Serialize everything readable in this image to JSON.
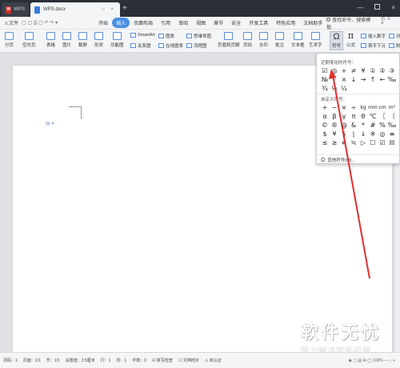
{
  "titlebar": {
    "home_tab": "WPS",
    "home_logo": "W",
    "doc_tab": "WPS.docx",
    "doc_tab_ctrls": "○ ×",
    "new_tab": "+",
    "min": "—",
    "close": "×"
  },
  "menubar": {
    "file": "≡ 文件",
    "quick_access": "▢ ▢ ⎙ ▢ ↶ ↷ ▾",
    "items": [
      "开始",
      "插入",
      "页面布局",
      "引用",
      "审阅",
      "视图",
      "章节",
      "安全",
      "开发工具",
      "特色应用",
      "文档助手"
    ],
    "search": "查找命令、搜索模板",
    "right_icons": "◴ ☺ ˄"
  },
  "ribbon": {
    "page_break": "分页",
    "blank_page": "空白页",
    "table": "表格",
    "picture": "图片",
    "screenshot": "截屏",
    "shapes": "形状",
    "function_chart": "功能图",
    "smartart": "SmartArt",
    "chart": "图表",
    "mindmap": "思维导图",
    "relation_chart": "关系图",
    "online_chart": "在线图表",
    "flowchart": "流程图",
    "header_footer": "页眉和页脚",
    "page_number": "页码",
    "watermark": "水印",
    "comment": "批注",
    "textbox": "文本框",
    "art_text": "艺术字",
    "symbol": "符号",
    "formula": "公式",
    "insert_number": "插入数字",
    "object": "对象",
    "attachment": "附件",
    "first_drop": "首字下沉",
    "omega": "Ω",
    "pi": "π"
  },
  "symbol_panel": {
    "recent_title": "近期使用的符号：",
    "recent": [
      "☑",
      "◎",
      "+",
      "≠",
      "¥",
      "①",
      "②",
      "③",
      "№",
      "√",
      "×",
      "↓",
      "→",
      "↑",
      "←",
      "‰",
      "¾",
      "½",
      "¼"
    ],
    "custom_title": "自定义符号：",
    "custom": [
      "+",
      "−",
      "×",
      "÷",
      "kg",
      "mm",
      "cm",
      "m²",
      "α",
      "β",
      "γ",
      "π",
      "θ",
      "℃",
      "〖",
      "〔",
      "©",
      "®",
      "@",
      "&",
      "*",
      "#",
      "%",
      "‰",
      "$",
      "¥",
      "§",
      "|",
      "↓",
      "※",
      "◎",
      "≡",
      "≤",
      "≥",
      "≌",
      "≒",
      "▷",
      "☐",
      "☑",
      "☒"
    ],
    "more": "其他符号(M)...",
    "more_icon": "Ω"
  },
  "statusbar": {
    "page": "页码：1",
    "pages": "页面：1/1",
    "section": "节：1/1",
    "setting": "设置值：2.5厘米",
    "row": "行：1",
    "col": "列：1",
    "words": "字数：0",
    "spell": "☑ 拼写检查",
    "doc_check": "☐ 文档校对",
    "cert": "⚠ 未认证",
    "right": "◉ ▢ ▤ ⊕ ◯ 100% — ○ +"
  },
  "watermark": {
    "main": "软件无忧",
    "sub": "努力解决软件问题"
  },
  "doc": {
    "para_icon": "▤ ▾"
  }
}
